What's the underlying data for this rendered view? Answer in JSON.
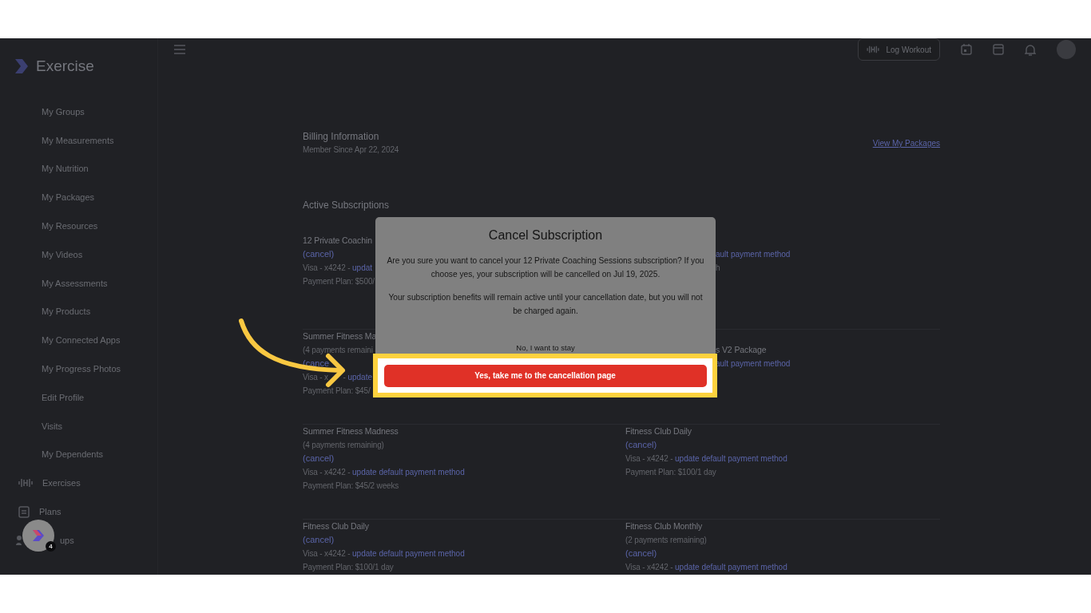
{
  "header": {
    "logo": "Exercise",
    "log_workout": "Log Workout"
  },
  "sidebar": {
    "items": [
      {
        "label": "My Groups",
        "kind": "sub"
      },
      {
        "label": "My Measurements",
        "kind": "sub"
      },
      {
        "label": "My Nutrition",
        "kind": "sub"
      },
      {
        "label": "My Packages",
        "kind": "sub"
      },
      {
        "label": "My Resources",
        "kind": "sub"
      },
      {
        "label": "My Videos",
        "kind": "sub"
      },
      {
        "label": "My Assessments",
        "kind": "sub"
      },
      {
        "label": "My Products",
        "kind": "sub"
      },
      {
        "label": "My Connected Apps",
        "kind": "sub"
      },
      {
        "label": "My Progress Photos",
        "kind": "sub"
      },
      {
        "label": "Edit Profile",
        "kind": "sub"
      },
      {
        "label": "Visits",
        "kind": "sub"
      },
      {
        "label": "My Dependents",
        "kind": "sub"
      },
      {
        "label": "Exercises",
        "kind": "dumbbell"
      },
      {
        "label": "Plans",
        "kind": "clipboard"
      },
      {
        "label": "ups",
        "kind": "people"
      }
    ]
  },
  "widget": {
    "badge": "4"
  },
  "billing": {
    "title": "Billing Information",
    "member_since": "Member Since Apr 22, 2024",
    "view_packages": "View My Packages"
  },
  "subscriptions": {
    "title": "Active Subscriptions",
    "rows": [
      {
        "left": {
          "title": [
            "12 Private Coachin"
          ],
          "cancel": [
            "(cancel)"
          ],
          "card": [
            "Visa - x4242 - "
          ],
          "update": "updat",
          "plan": [
            "Payment Plan: $500/"
          ]
        },
        "right": {
          "clipped": true,
          "update": "ault payment method",
          "plan": [
            "h"
          ]
        }
      },
      {
        "left": {
          "title": [
            "Summer Fitness Ma"
          ],
          "remaining": [
            "(4 payments remaini"
          ],
          "cancel": [
            "(cance"
          ],
          "card": [
            "Visa - x",
            " - "
          ],
          "update": "update",
          "plan": [
            "Payment Plan: $45/"
          ]
        },
        "right": {
          "clipped": true,
          "title": [
            "s V2 Package"
          ],
          "update": "ault payment method"
        }
      },
      {
        "left": {
          "title": [
            "Summer Fitness Madness"
          ],
          "remaining": [
            "(4 payments remaining)"
          ],
          "cancel": [
            "(cancel)"
          ],
          "card": [
            "Visa - x4242 - "
          ],
          "update": "update default payment method",
          "plan": [
            "Payment Plan: $45/2 weeks"
          ]
        },
        "right": {
          "clipped": false,
          "title": [
            "Fitness Club Daily"
          ],
          "cancel": [
            "(cancel)"
          ],
          "card": [
            "Visa - x4242 - "
          ],
          "update": "update default payment method",
          "plan": [
            "Payment Plan: $100/1 day"
          ]
        }
      },
      {
        "left": {
          "title": [
            "Fitness Club Daily"
          ],
          "cancel": [
            "(cancel)"
          ],
          "card": [
            "Visa - x4242 - "
          ],
          "update": "update default payment method",
          "plan": [
            "Payment Plan: $100/1 day"
          ]
        },
        "right": {
          "clipped": false,
          "title": [
            "Fitness Club Monthly"
          ],
          "remaining": [
            "(2 payments remaining)"
          ],
          "cancel": [
            "(cancel)"
          ],
          "card": [
            "Visa - x4242 - "
          ],
          "update": "update default payment method"
        }
      }
    ]
  },
  "modal": {
    "title": "Cancel Subscription",
    "paragraphs": [
      "Are you sure you want to cancel your 12 Private Coaching Sessions subscription? If you choose yes, your subscription will be cancelled on Jul 19, 2025.",
      "Your subscription benefits will remain active until your cancellation date, but you will not be charged again."
    ],
    "stay": "No, I want to stay",
    "confirm": "Yes, take me to the cancellation page"
  }
}
